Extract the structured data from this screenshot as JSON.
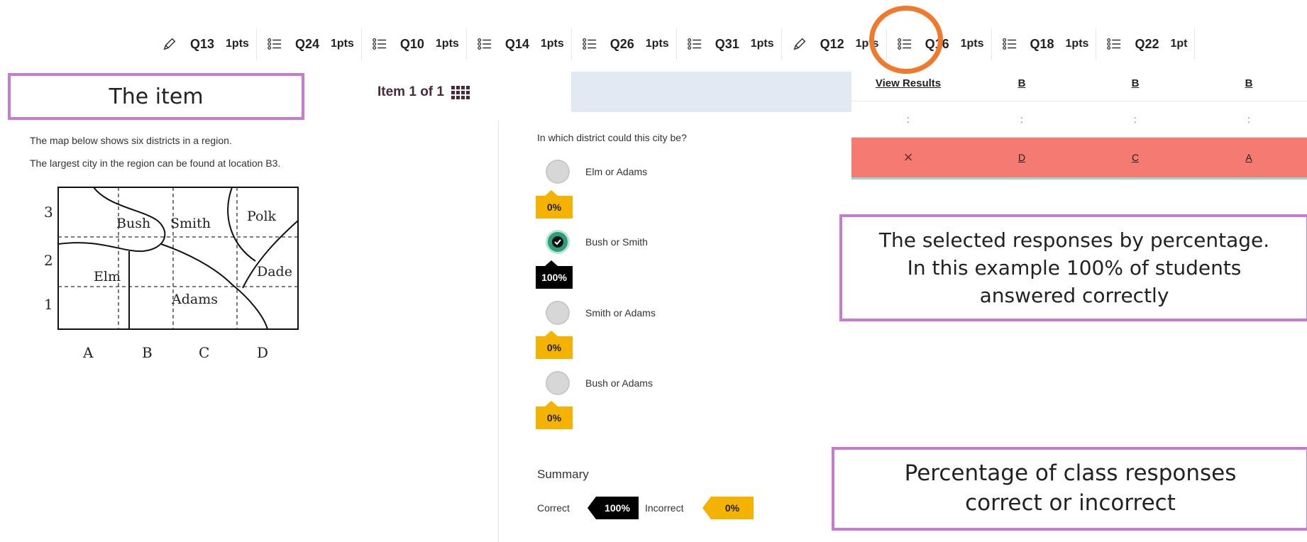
{
  "questions": [
    {
      "id": "Q13",
      "pts": "1pts",
      "icon": "pencil-icon"
    },
    {
      "id": "Q24",
      "pts": "1pts",
      "icon": "list-icon"
    },
    {
      "id": "Q10",
      "pts": "1pts",
      "icon": "list-icon"
    },
    {
      "id": "Q14",
      "pts": "1pts",
      "icon": "list-icon"
    },
    {
      "id": "Q26",
      "pts": "1pts",
      "icon": "list-icon"
    },
    {
      "id": "Q31",
      "pts": "1pts",
      "icon": "list-icon"
    },
    {
      "id": "Q12",
      "pts": "1pts",
      "icon": "pencil-icon"
    },
    {
      "id": "Q16",
      "pts": "1pts",
      "icon": "list-icon"
    },
    {
      "id": "Q18",
      "pts": "1pts",
      "icon": "list-icon"
    },
    {
      "id": "Q22",
      "pts": "1pt",
      "icon": "list-icon"
    }
  ],
  "item_header": {
    "counter": "Item 1 of 1"
  },
  "callouts": {
    "item": "The item",
    "selected_line1": "The selected responses by percentage.",
    "selected_line2": "In this example 100% of students",
    "selected_line3": "answered correctly",
    "summary_line1": "Percentage of class responses",
    "summary_line2": "correct or incorrect"
  },
  "stimulus": {
    "line1": "The map below shows six districts in a region.",
    "line2": "The largest city in the region can be found at location B3.",
    "map": {
      "row_labels": [
        "3",
        "2",
        "1"
      ],
      "col_labels": [
        "A",
        "B",
        "C",
        "D"
      ],
      "districts": [
        "Bush",
        "Smith",
        "Polk",
        "Elm",
        "Dade",
        "Adams"
      ]
    }
  },
  "question": {
    "prompt": "In which district could this city be?",
    "options": [
      {
        "label": "Elm or Adams",
        "percent": "0%",
        "correct": false
      },
      {
        "label": "Bush or Smith",
        "percent": "100%",
        "correct": true
      },
      {
        "label": "Smith or Adams",
        "percent": "0%",
        "correct": false
      },
      {
        "label": "Bush or Adams",
        "percent": "0%",
        "correct": false
      }
    ]
  },
  "summary": {
    "title": "Summary",
    "correct_label": "Correct",
    "correct_value": "100%",
    "incorrect_label": "Incorrect",
    "incorrect_value": "0%"
  },
  "results": {
    "header": [
      "View Results",
      "B",
      "B",
      "B"
    ],
    "dots": [
      ":",
      ":",
      ":",
      ":"
    ],
    "answers": [
      "×",
      "D",
      "C",
      "A"
    ]
  },
  "colors": {
    "callout_border": "#c77bd0",
    "highlight": "#ef7a2e",
    "badge_yellow": "#f5b301",
    "correct_green": "#2f9c7a",
    "incorrect_row": "#f47a72"
  }
}
